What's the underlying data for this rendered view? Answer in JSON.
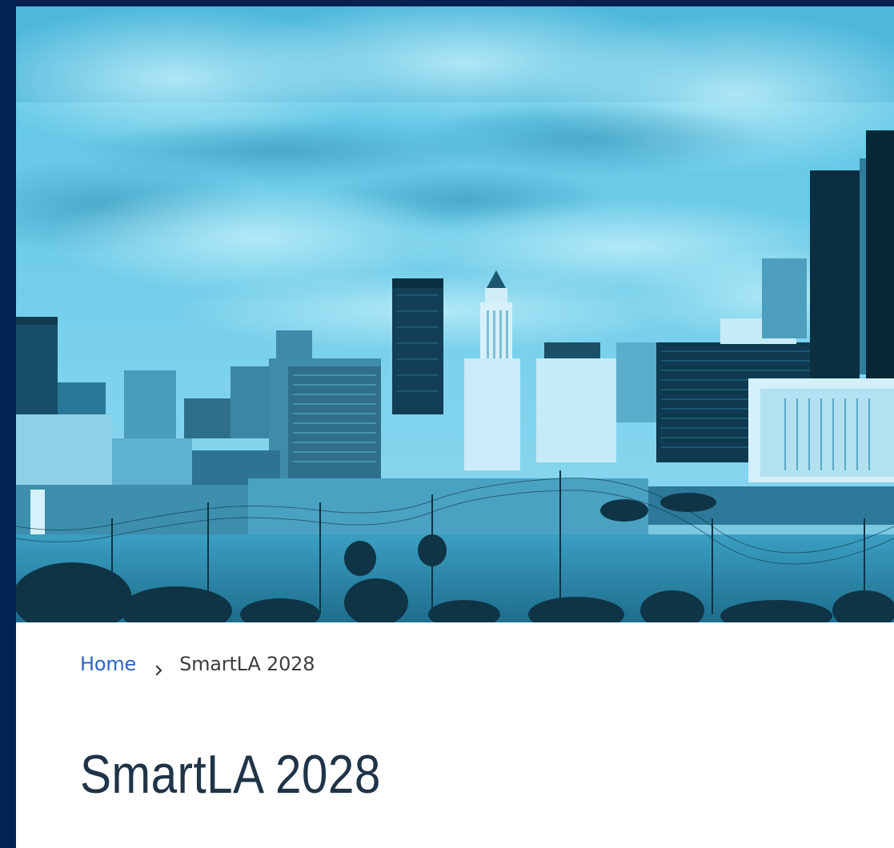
{
  "hero": {
    "icon": "city-skyline-photo",
    "tint_color": "#47b3d6"
  },
  "breadcrumb": {
    "home_label": "Home",
    "separator_icon": "chevron-right-icon",
    "current_label": "SmartLA 2028"
  },
  "page_title": "SmartLA 2028",
  "colors": {
    "frame": "#032251",
    "link": "#2c63c4",
    "title": "#1f3448",
    "breadcrumb_text": "#3d3d3d"
  }
}
